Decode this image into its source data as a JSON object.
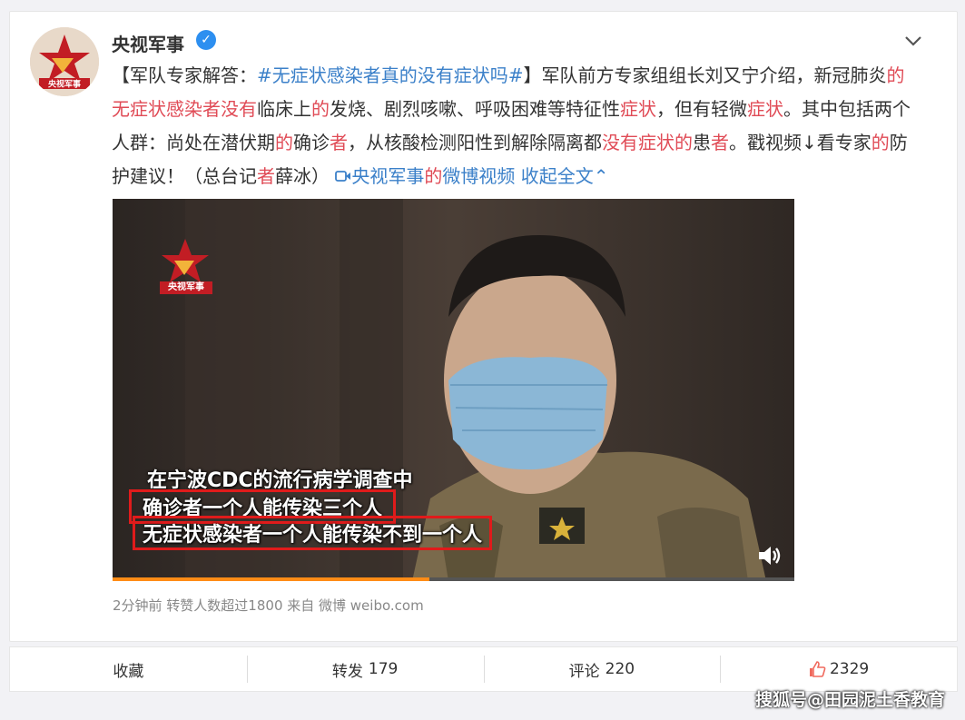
{
  "post": {
    "username": "央视军事",
    "verified_icon": "verified-badge-icon",
    "text": {
      "p1": "【军队专家解答：",
      "hashtag": "#无症状感染者真的没有症状吗#",
      "p2": "】军队前方专家组组长刘又宁介绍，新冠肺炎",
      "p3": "的无症状感染者没有",
      "p4": "临床上",
      "p5": "的",
      "p6": "发烧、剧烈咳嗽、呼吸困难等特征性",
      "p7": "症状",
      "p8": "，但有轻微",
      "p9": "症状",
      "p10": "。其中包括两个人群：尚处在潜伏期",
      "p11": "的",
      "p12": "确诊",
      "p13": "者",
      "p14": "，从核酸检测阳性到解除隔离都",
      "p15": "没有症状的",
      "p16": "患",
      "p17": "者",
      "p18": "。戳视频↓看专家",
      "p19": "的",
      "p20": "防护建议！（总台记",
      "p21": "者",
      "p22": "薛冰）",
      "video_link": "央视军事",
      "video_link_hl": "的",
      "video_link2": "微博视频",
      "collapse": "收起全文"
    },
    "video": {
      "logo_label": "央视军事",
      "subtitle1": "在宁波CDC的流行病学调查中",
      "subtitle2": "确诊者一个人能传染三个人",
      "subtitle3": "无症状感染者一个人能传染不到一个人",
      "progress_percent": 46.5
    },
    "meta": "2分钟前  转赞人数超过1800   来自 微博 weibo.com"
  },
  "actions": {
    "favorite": "收藏",
    "repost_label": "转发",
    "repost_count": "179",
    "comment_label": "评论",
    "comment_count": "220",
    "like_count": "2329"
  },
  "watermark": "搜狐号@田园泥土香教育",
  "colors": {
    "highlight": "#e04b56",
    "link": "#3b80c9",
    "progress": "#ff8c16",
    "subtitle_box": "#e01b1b"
  }
}
